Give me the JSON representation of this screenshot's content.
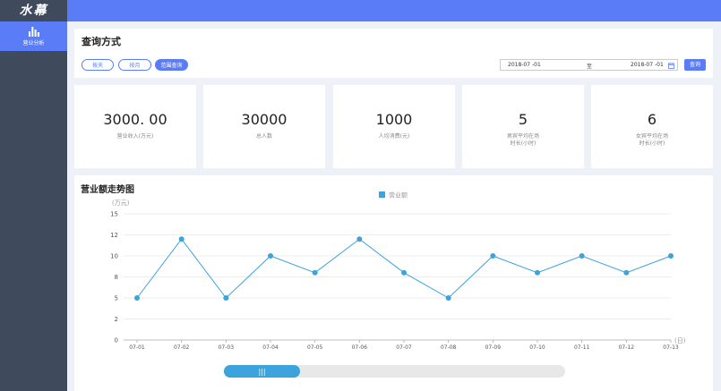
{
  "app": {
    "logo": "水幕"
  },
  "sidebar": {
    "items": [
      {
        "label": "营业分析",
        "icon": "bar-chart-icon"
      }
    ]
  },
  "query": {
    "title": "查询方式",
    "buttons": [
      {
        "label": "按天",
        "active": false
      },
      {
        "label": "按月",
        "active": false
      },
      {
        "label": "范围查询",
        "active": true
      }
    ],
    "date_from": "2018-07 -01",
    "separator": "至",
    "date_to": "2018-07 -01",
    "search_label": "查询"
  },
  "stats": [
    {
      "value": "3000. 00",
      "label": "营业收入(万元)",
      "label2": ""
    },
    {
      "value": "30000",
      "label": "总人数",
      "label2": ""
    },
    {
      "value": "1000",
      "label": "人均消费(元)",
      "label2": ""
    },
    {
      "value": "5",
      "label": "男宾平均在场",
      "label2": "时长(小时)"
    },
    {
      "value": "6",
      "label": "女宾平均在场",
      "label2": "时长(小时)"
    }
  ],
  "chart": {
    "title": "营业额走势图"
  },
  "chart_data": {
    "type": "line",
    "categories": [
      "07-01",
      "07-02",
      "07-03",
      "07-04",
      "07-05",
      "07-06",
      "07-07",
      "07-08",
      "07-09",
      "07-10",
      "07-11",
      "07-12",
      "07-13"
    ],
    "series": [
      {
        "name": "营业额",
        "values": [
          5,
          12,
          5,
          10,
          8,
          12,
          8,
          5,
          10,
          8,
          10,
          8,
          10
        ]
      }
    ],
    "ylabel": "(万元)",
    "xlabel": "(日)",
    "yticks": [
      0,
      2.5,
      5,
      7.5,
      10,
      12.5,
      15
    ],
    "ytick_labels": [
      "0",
      "2",
      "5",
      "8",
      "10",
      "12",
      "15"
    ],
    "ylim": [
      0,
      15
    ],
    "legend": "top-center",
    "grid": true,
    "color": "#3ca3dc"
  },
  "scrollbar": {
    "handle_label": "|||",
    "position": 0.22
  }
}
